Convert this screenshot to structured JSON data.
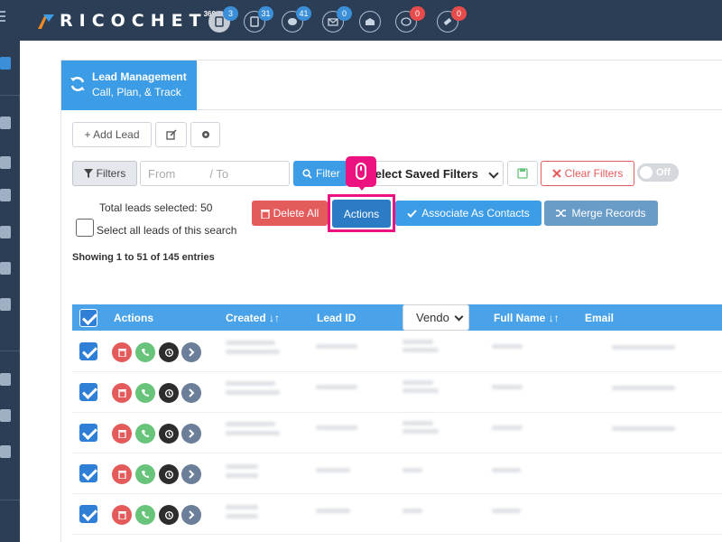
{
  "topbar": {
    "logo_text": "RICOCHET",
    "logo_sup": "360",
    "icons": [
      {
        "name": "leads-icon",
        "badge": "3",
        "badge_color": "blue"
      },
      {
        "name": "documents-icon",
        "badge": "31",
        "badge_color": "blue"
      },
      {
        "name": "chat-icon",
        "badge": "41",
        "badge_color": "blue"
      },
      {
        "name": "email-icon",
        "badge": "0",
        "badge_color": "blue"
      },
      {
        "name": "email-open-icon",
        "badge": "",
        "badge_color": ""
      },
      {
        "name": "comment-icon",
        "badge": "0",
        "badge_color": "red"
      },
      {
        "name": "ticket-icon",
        "badge": "0",
        "badge_color": "red"
      }
    ]
  },
  "panel": {
    "title": "Lead Management",
    "subtitle": "Call, Plan, & Track"
  },
  "toolbar": {
    "add_lead": "+ Add Lead"
  },
  "filters": {
    "filters_label": "Filters",
    "from_placeholder": "From",
    "to_placeholder": "/ To",
    "filter_button": "Filter",
    "saved_filters": "Select Saved Filters",
    "clear_filters": "Clear Filters",
    "toggle_label": "Off"
  },
  "selection": {
    "total_selected": "Total leads selected: 50",
    "select_all": "Select all leads of this search"
  },
  "actions": {
    "delete_all": "Delete All",
    "actions": "Actions",
    "associate": "Associate As Contacts",
    "merge": "Merge Records"
  },
  "showing": "Showing 1 to 51 of 145 entries",
  "table": {
    "headers": {
      "actions": "Actions",
      "created": "Created",
      "lead_id": "Lead ID",
      "vendor": "Vendo",
      "full_name": "Full Name",
      "email": "Email"
    }
  },
  "colors": {
    "accent": "#3c9ce6",
    "highlight": "#ec1381",
    "topbar": "#2c3e55"
  }
}
